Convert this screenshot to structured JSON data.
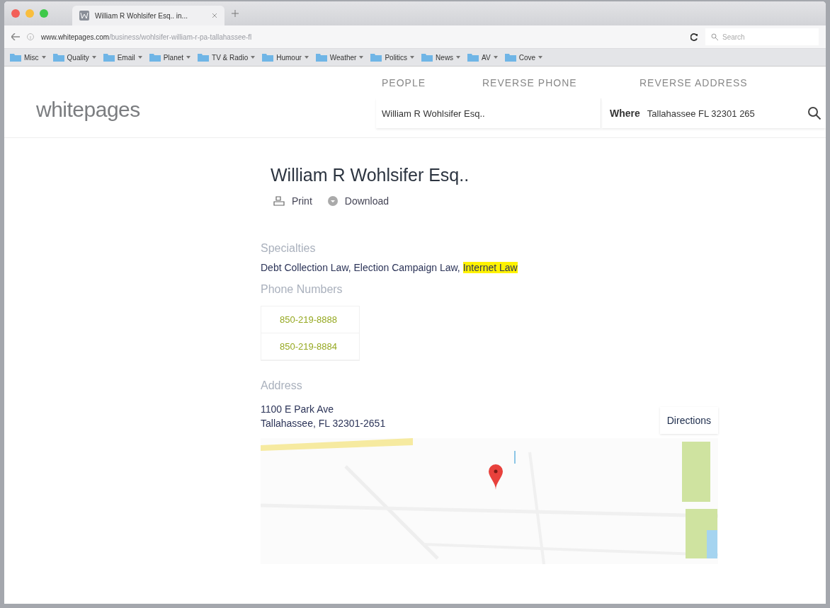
{
  "browser": {
    "tab": {
      "title": "William R Wohlsifer Esq.. in..."
    },
    "address_bar": {
      "domain": "www.whitepages.com",
      "path": "/business/wohlsifer-william-r-pa-tallahassee-fl"
    },
    "search": {
      "placeholder": "Search"
    },
    "bookmarks": [
      {
        "label": "Misc"
      },
      {
        "label": "Quality"
      },
      {
        "label": "Email"
      },
      {
        "label": "Planet"
      },
      {
        "label": "TV & Radio"
      },
      {
        "label": "Humour"
      },
      {
        "label": "Weather"
      },
      {
        "label": "Politics"
      },
      {
        "label": "News"
      },
      {
        "label": "AV"
      },
      {
        "label": "Cove"
      }
    ]
  },
  "site": {
    "logo": "whitepages",
    "nav": [
      {
        "label": "PEOPLE"
      },
      {
        "label": "REVERSE PHONE"
      },
      {
        "label": "REVERSE ADDRESS"
      }
    ],
    "search": {
      "name_value": "William R Wohlsifer Esq..",
      "where_label": "Where",
      "where_value": "Tallahassee FL 32301 265"
    }
  },
  "listing": {
    "title": "William R Wohlsifer Esq..",
    "actions": [
      {
        "kind": "print",
        "label": "Print"
      },
      {
        "kind": "download",
        "label": "Download"
      }
    ],
    "specialties": {
      "heading": "Specialties",
      "items": [
        {
          "text": "Debt Collection Law,",
          "highlighted": false
        },
        {
          "text": "Election Campaign Law,",
          "highlighted": false
        },
        {
          "text": "Internet Law",
          "highlighted": true
        }
      ]
    },
    "phones": {
      "heading": "Phone Numbers",
      "numbers": [
        "850-219-8888",
        "850-219-8884"
      ]
    },
    "address": {
      "heading": "Address",
      "lines": [
        "1100 E Park Ave",
        "Tallahassee, FL 32301-2651"
      ],
      "directions": "Directions",
      "map": {
        "kind": "picture"
      }
    }
  }
}
